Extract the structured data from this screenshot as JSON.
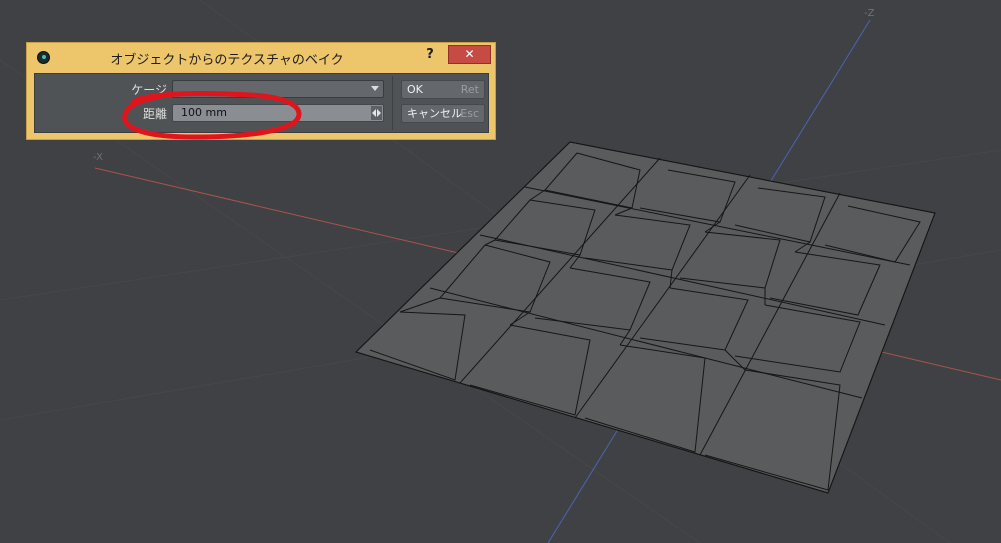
{
  "viewport": {
    "axis_labels": {
      "neg_x": "-X",
      "neg_z": "-Z"
    }
  },
  "dialog": {
    "title": "オブジェクトからのテクスチャのベイク",
    "help": "?",
    "close": "✕",
    "fields": {
      "cage_label": "ケージ",
      "distance_label": "距離",
      "distance_value": "100 mm"
    },
    "buttons": {
      "ok_label": "OK",
      "ok_key": "Ret",
      "cancel_label": "キャンセル",
      "cancel_key": "Esc"
    }
  },
  "colors": {
    "titlebar": "#edc56b",
    "close_button": "#c64b44",
    "annotation_circle": "#e0141c",
    "mesh_fill": "#5a5b5c",
    "x_axis": "#a8554a",
    "z_axis": "#4c64b4"
  }
}
